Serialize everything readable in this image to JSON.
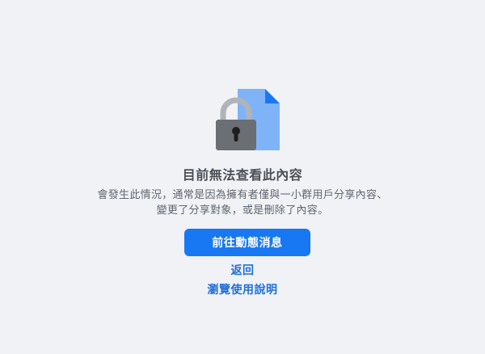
{
  "colors": {
    "background": "#f0f2f5",
    "primary_button": "#1877f2",
    "link": "#216fdb",
    "document": "#7fb3f8",
    "document_fold": "#1877f2",
    "lock_body": "#6b6e73",
    "lock_shackle": "#b0b3b8"
  },
  "illustration": {
    "icon": "locked-document-icon"
  },
  "content": {
    "title": "目前無法查看此內容",
    "description": "會發生此情況，通常是因為擁有者僅與一小群用戶分享內容、變更了分享對象，或是刪除了內容。"
  },
  "actions": {
    "primary_label": "前往動態消息",
    "back_label": "返回",
    "help_label": "瀏覽使用說明"
  }
}
